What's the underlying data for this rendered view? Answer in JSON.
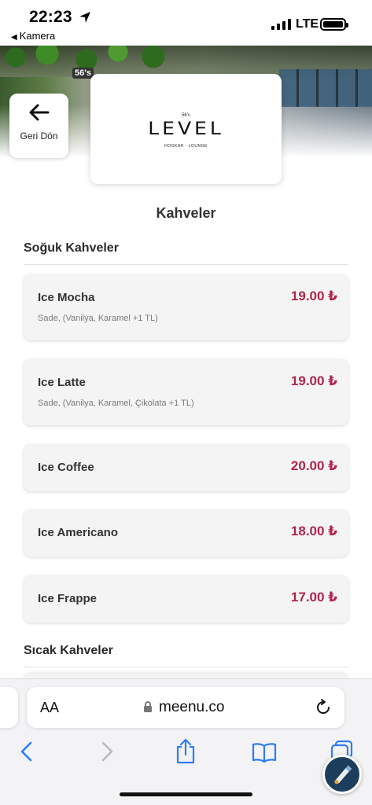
{
  "status_bar": {
    "time": "22:23",
    "back_app": "Kamera",
    "network": "LTE"
  },
  "header": {
    "back_label": "Geri Dön",
    "logo_small": "56's",
    "logo_word": "LEVEL",
    "logo_tagline": "HOOKAH · LOUNGE",
    "hero_sign": "56's"
  },
  "page_title": "Kahveler",
  "sections": [
    {
      "title": "Soğuk Kahveler",
      "items": [
        {
          "name": "Ice Mocha",
          "desc": "Sade, (Vanilya, Karamel +1 TL)",
          "price": "19.00 ₺"
        },
        {
          "name": "Ice Latte",
          "desc": "Sade, (Vanilya, Karamel, Çikolata +1 TL)",
          "price": "19.00 ₺"
        },
        {
          "name": "Ice Coffee",
          "desc": "",
          "price": "20.00 ₺"
        },
        {
          "name": "Ice Americano",
          "desc": "",
          "price": "18.00 ₺"
        },
        {
          "name": "Ice Frappe",
          "desc": "",
          "price": "17.00 ₺"
        }
      ]
    },
    {
      "title": "Sıcak Kahveler",
      "items": []
    }
  ],
  "browser": {
    "aa_label": "AA",
    "url": "meenu.co",
    "icons": [
      "back-icon",
      "forward-icon",
      "share-icon",
      "bookmarks-icon",
      "tabs-icon",
      "lock-icon",
      "reload-icon"
    ]
  },
  "colors": {
    "price": "#b0254a",
    "card_bg": "#f4f4f4",
    "toolbar_blue": "#2f7cf6"
  }
}
